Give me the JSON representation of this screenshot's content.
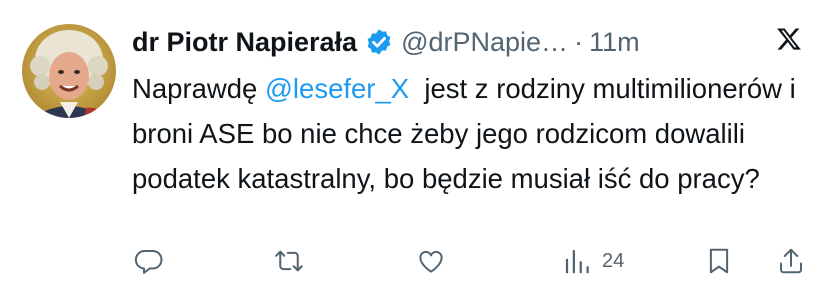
{
  "tweet": {
    "display_name": "dr Piotr Napierała",
    "handle": "@drPNapie…",
    "separator": "·",
    "timestamp": "11m",
    "text_segments": [
      {
        "text": "Naprawdę ",
        "mention": false
      },
      {
        "text": "@lesefer_X",
        "mention": true
      },
      {
        "text": "  jest z rodziny multimilionerów i broni ASE bo nie chce żeby jego rodzicom dowalili podatek katastralny, bo będzie musiał iść do pracy?",
        "mention": false
      }
    ],
    "views_count": "24"
  },
  "icons": {
    "avatar": "profile-photo",
    "verified": "verified-badge-icon",
    "platform": "x-logo-icon",
    "actions": [
      "reply-icon",
      "retweet-icon",
      "like-icon",
      "views-icon",
      "bookmark-icon",
      "share-icon"
    ]
  },
  "colors": {
    "text": "#0f1419",
    "muted": "#536471",
    "accent": "#1d9bf0",
    "background": "#ffffff"
  }
}
